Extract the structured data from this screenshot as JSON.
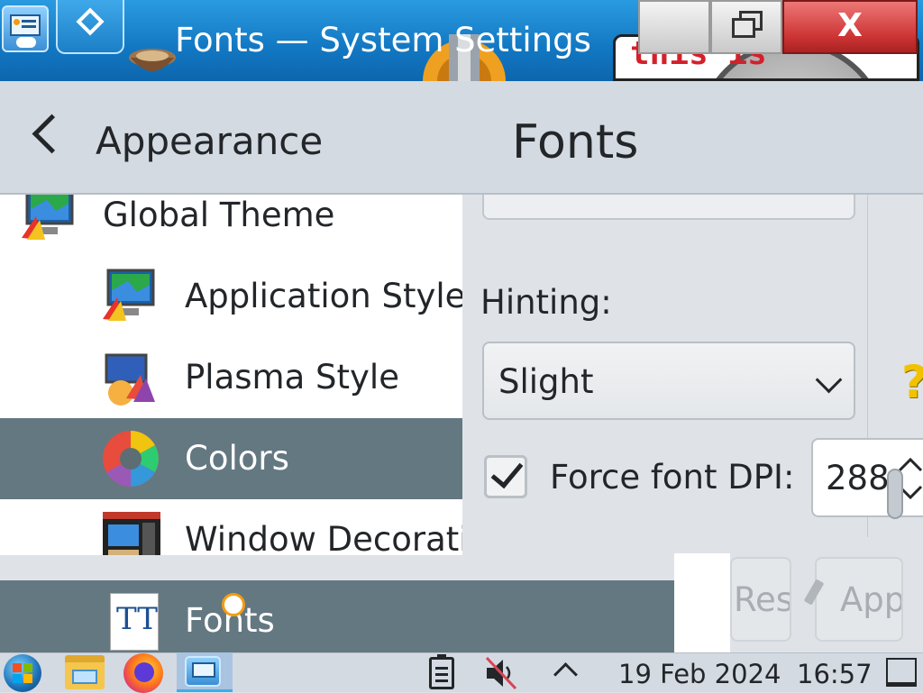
{
  "window": {
    "title": "Fonts — System Settings",
    "sticker_text": "this is"
  },
  "controls": {
    "close_glyph": "X"
  },
  "header": {
    "back_label": "Appearance",
    "page_title": "Fonts"
  },
  "sidebar": {
    "items": [
      {
        "label": "Global Theme",
        "icon": "global-theme-icon",
        "selected": false
      },
      {
        "label": "Application Style",
        "icon": "application-style-icon",
        "selected": false
      },
      {
        "label": "Plasma Style",
        "icon": "plasma-style-icon",
        "selected": false
      },
      {
        "label": "Colors",
        "icon": "colors-icon",
        "selected": true
      },
      {
        "label": "Window Decorations",
        "icon": "window-decorations-icon",
        "selected": false
      },
      {
        "label": "Fonts",
        "icon": "fonts-icon",
        "selected": true
      }
    ],
    "fonts_icon_glyph": "TT"
  },
  "content": {
    "hinting_label": "Hinting:",
    "hinting_value": "Slight",
    "force_dpi_label": "Force font DPI:",
    "force_dpi_checked": true,
    "force_dpi_value": "288"
  },
  "buttons": {
    "reset_label": "Reset",
    "apply_label": "Apply"
  },
  "taskbar": {
    "date": "19 Feb 2024",
    "time": "16:57"
  },
  "colors": {
    "titlebar": "#1277c2",
    "selection": "#647882",
    "accent": "#3daee9"
  }
}
